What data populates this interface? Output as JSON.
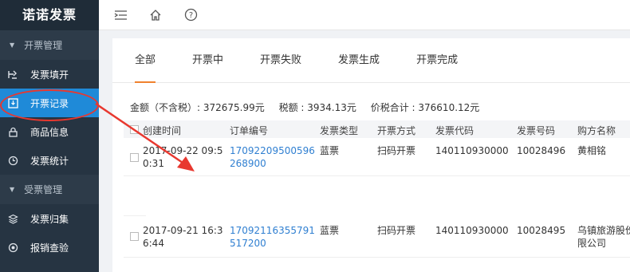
{
  "brand": {
    "title": "诺诺发票"
  },
  "sidebar": {
    "groups": [
      {
        "label": "开票管理",
        "items": [
          {
            "label": "发票填开",
            "icon": "invoice-fill-icon"
          },
          {
            "label": "开票记录",
            "icon": "record-icon",
            "active": true
          },
          {
            "label": "商品信息",
            "icon": "lock-icon"
          },
          {
            "label": "发票统计",
            "icon": "clock-icon"
          }
        ]
      },
      {
        "label": "受票管理",
        "items": [
          {
            "label": "发票归集",
            "icon": "layers-icon"
          },
          {
            "label": "报销查验",
            "icon": "circle-icon"
          }
        ]
      }
    ]
  },
  "topbar": {
    "icons": [
      "menu-fold-icon",
      "home-icon",
      "help-icon"
    ]
  },
  "tabs": [
    "全部",
    "开票中",
    "开票失败",
    "发票生成",
    "开票完成"
  ],
  "active_tab": "全部",
  "summary": {
    "amount_excl_tax": "金额（不含税）: 372675.99元",
    "tax": "税额 : 3934.13元",
    "total": "价税合计 : 376610.12元"
  },
  "table": {
    "headers": [
      "创建时间",
      "订单编号",
      "发票类型",
      "开票方式",
      "发票代码",
      "发票号码",
      "购方名称"
    ],
    "rows": [
      {
        "time_line1": "2017-09-22 09:5",
        "time_line2": "0:31",
        "order_line1": "17092209500596",
        "order_line2": "268900",
        "type": "蓝票",
        "method": "扫码开票",
        "code": "140110930000",
        "number": "10028496",
        "buyer_line1": "黄相铭",
        "buyer_line2": ""
      },
      {
        "time_line1": "2017-09-21 16:3",
        "time_line2": "6:44",
        "order_line1": "17092116355791",
        "order_line2": "517200",
        "type": "蓝票",
        "method": "扫码开票",
        "code": "140110930000",
        "number": "10028495",
        "buyer_line1": "乌镇旅游股份",
        "buyer_line2": "限公司"
      }
    ]
  },
  "colors": {
    "sidebar_bg": "#263442",
    "active_nav": "#1f8ad8",
    "tab_underline": "#f0822e",
    "link": "#2f7fd1",
    "annotation": "#e8382f"
  }
}
